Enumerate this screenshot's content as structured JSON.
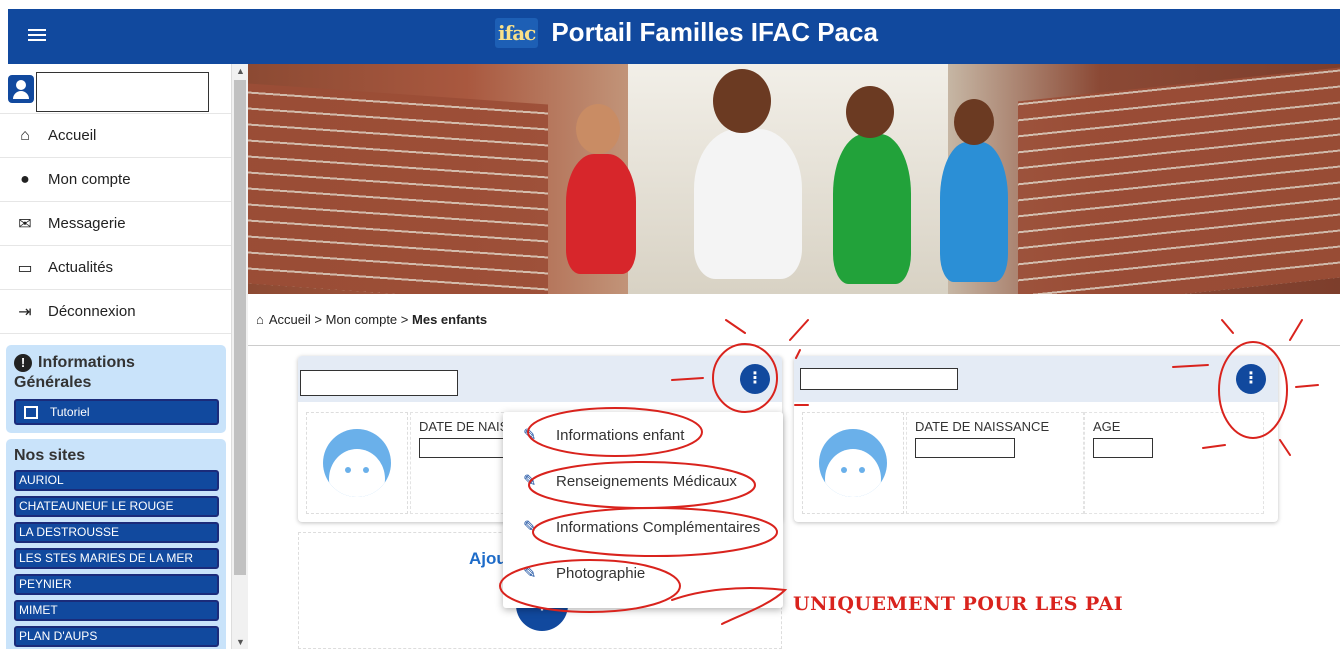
{
  "header": {
    "logo_text": "ifac",
    "title": "Portail Familles IFAC Paca"
  },
  "sidebar": {
    "user_name": "",
    "nav": [
      {
        "label": "Accueil",
        "icon": "home-icon"
      },
      {
        "label": "Mon compte",
        "icon": "account-icon"
      },
      {
        "label": "Messagerie",
        "icon": "mail-icon"
      },
      {
        "label": "Actualités",
        "icon": "news-icon"
      },
      {
        "label": "Déconnexion",
        "icon": "logout-icon"
      }
    ],
    "info_panel": {
      "title_line1": "Informations",
      "title_line2": "Générales",
      "tutorial_label": "Tutoriel"
    },
    "sites_title": "Nos sites",
    "sites": [
      "AURIOL",
      "CHATEAUNEUF LE ROUGE",
      "LA DESTROUSSE",
      "LES STES MARIES DE LA MER",
      "PEYNIER",
      "MIMET",
      "PLAN D'AUPS"
    ]
  },
  "breadcrumb": {
    "home": "Accueil",
    "sep1": ">",
    "account": "Mon compte",
    "sep2": ">",
    "current": "Mes enfants"
  },
  "children": [
    {
      "name": "",
      "date_label": "DATE DE NAISS",
      "date_value": ""
    },
    {
      "name": "",
      "date_label": "DATE DE NAISSANCE",
      "date_value": "",
      "age_label": "AGE",
      "age_value": ""
    }
  ],
  "add_child": {
    "label": "Ajout",
    "button": "+"
  },
  "menu": [
    {
      "label": "Informations enfant"
    },
    {
      "label": "Renseignements Médicaux"
    },
    {
      "label": "Informations Complémentaires"
    },
    {
      "label": "Photographie"
    }
  ],
  "annotation": {
    "note": "UNIQUEMENT POUR LES PAI",
    "color": "#d9231d"
  },
  "colors": {
    "primary": "#11499e",
    "panel": "#c9e3fa",
    "card_head": "#e4ebf5"
  }
}
